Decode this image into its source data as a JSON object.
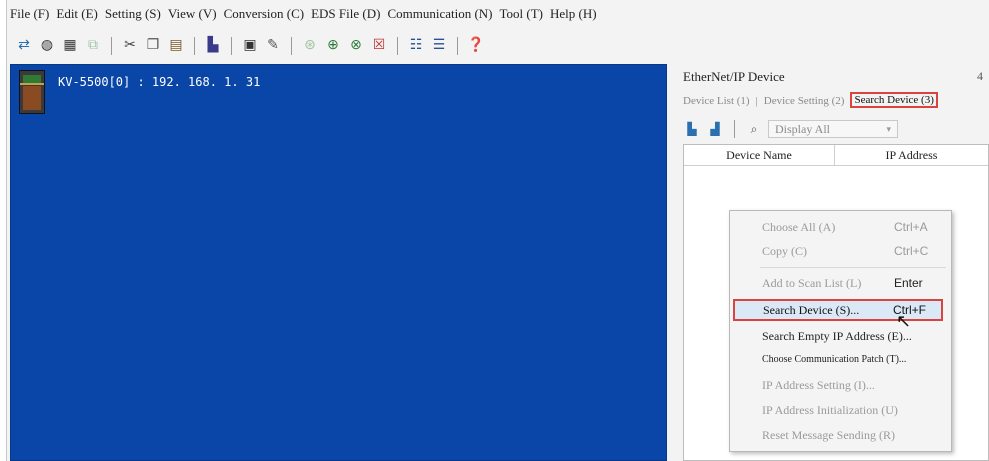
{
  "menu": [
    "File (F)",
    "Edit (E)",
    "Setting (S)",
    "View (V)",
    "Conversion (C)",
    "EDS File (D)",
    "Communication (N)",
    "Tool (T)",
    "Help (H)"
  ],
  "toolbar_icons": [
    "connect-icon",
    "monitor-icon",
    "network-icon",
    "disabled-icon",
    "cut-icon",
    "copy-icon",
    "paste-icon",
    "tree-icon",
    "edit-icon",
    "brush-icon",
    "disabled-tool-icon",
    "search-icon",
    "monitor2-icon",
    "check-icon",
    "table-icon",
    "list-icon",
    "help-icon"
  ],
  "left_panel": {
    "device_label": "KV-5500[0] : 192. 168. 1. 31",
    "bg_color": "#0a45a8"
  },
  "right_panel": {
    "title": "EtherNet/IP Device",
    "title_edge": "4",
    "tabs": {
      "device_list": "Device List (1)",
      "device_setting": "Device Setting (2)",
      "search_device": "Search Device (3)"
    },
    "filter": "Display All",
    "columns": {
      "device_name": "Device Name",
      "ip_address": "IP Address"
    }
  },
  "context_menu": {
    "choose_all": {
      "label": "Choose All (A)",
      "shortcut": "Ctrl+A"
    },
    "copy": {
      "label": "Copy (C)",
      "shortcut": "Ctrl+C"
    },
    "add_to_scan": {
      "label": "Add to Scan List (L)",
      "shortcut": "Enter"
    },
    "search_device": {
      "label": "Search Device (S)...",
      "shortcut": "Ctrl+F"
    },
    "search_empty_ip": {
      "label": "Search Empty IP Address (E)..."
    },
    "choose_comm_path": {
      "label": "Choose Communication Patch (T)..."
    },
    "ip_setting": {
      "label": "IP Address Setting (I)..."
    },
    "ip_init": {
      "label": "IP Address Initialization (U)"
    },
    "reset_msg": {
      "label": "Reset Message Sending (R)"
    }
  },
  "colors": {
    "highlight_border": "#d9443e",
    "selected_bg": "#dbe9f7"
  }
}
